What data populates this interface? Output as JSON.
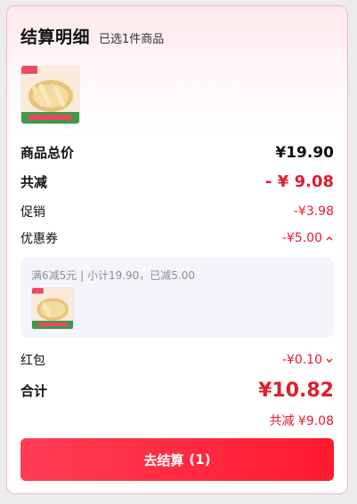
{
  "header": {
    "title": "结算明细",
    "selected": "已选1件商品"
  },
  "summary": {
    "goods_total_label": "商品总价",
    "goods_total_value": "¥19.90",
    "total_reduction_label": "共减",
    "total_reduction_value": "- ¥ 9.08",
    "promo_label": "促销",
    "promo_value": "-¥3.98",
    "coupon_label": "优惠券",
    "coupon_value": "-¥5.00",
    "coupon_detail": "满6减5元 | 小计19.90，已减5.00",
    "redpack_label": "红包",
    "redpack_value": "-¥0.10",
    "total_label": "合计",
    "total_value": "¥10.82",
    "total_sub": "共减 ¥9.08"
  },
  "checkout": {
    "label": "去结算",
    "count": "(1)"
  },
  "icons": {
    "coupon_toggle": "chevron-up-icon",
    "redpack_toggle": "chevron-down-icon"
  },
  "colors": {
    "accent": "#e11d2e",
    "button_start": "#ff3d55",
    "button_end": "#ff1a2e"
  }
}
